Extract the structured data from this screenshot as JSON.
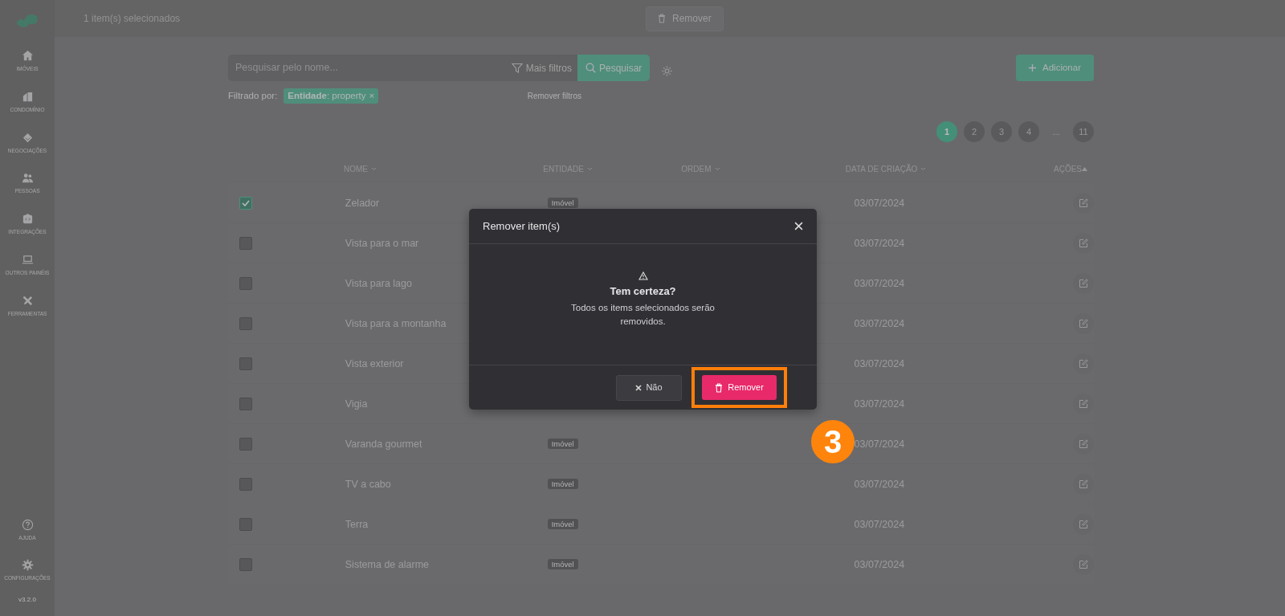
{
  "topbar": {
    "selection_text": "1 item(s) selecionados",
    "remove_button": "Remover"
  },
  "sidebar": {
    "items": [
      {
        "label": "IMÓVEIS"
      },
      {
        "label": "CONDOMÍNIO"
      },
      {
        "label": "NEGOCIAÇÕES"
      },
      {
        "label": "PESSOAS"
      },
      {
        "label": "INTEGRAÇÕES"
      },
      {
        "label": "OUTROS PAINÉIS"
      },
      {
        "label": "FERRAMENTAS"
      }
    ],
    "footer_items": [
      {
        "label": "AJUDA"
      },
      {
        "label": "CONFIGURAÇÕES"
      }
    ],
    "version": "v3.2.0"
  },
  "toolbar": {
    "search_placeholder": "Pesquisar pelo nome...",
    "filters_button": "Mais filtros",
    "search_button": "Pesquisar",
    "add_button": "Adicionar",
    "filter_label": "Filtrado por:",
    "filter_tag": "**Entidade**: property",
    "filter_tag_close": "×",
    "clear_filters": "Remover filtros"
  },
  "pagination": [
    {
      "label": "1",
      "selected": true
    },
    {
      "label": "2",
      "selected": false
    },
    {
      "label": "3",
      "selected": false
    },
    {
      "label": "4",
      "selected": false
    },
    {
      "label": "...",
      "kind": "ellipsis"
    },
    {
      "label": "11",
      "selected": false
    }
  ],
  "table": {
    "columns": [
      "NOME",
      "ENTIDADE",
      "ORDEM",
      "DATA DE CRIAÇÃO",
      "AÇÕES"
    ],
    "rows": [
      {
        "name": "Zelador",
        "entity": "Imóvel",
        "date": "03/07/2024",
        "checked": true
      },
      {
        "name": "Vista para o mar",
        "date": "03/07/2024",
        "checked": false
      },
      {
        "name": "Vista para lago",
        "date": "03/07/2024",
        "checked": false
      },
      {
        "name": "Vista para a montanha",
        "date": "03/07/2024",
        "checked": false
      },
      {
        "name": "Vista exterior",
        "date": "03/07/2024",
        "checked": false
      },
      {
        "name": "Vigia",
        "date": "03/07/2024",
        "checked": false
      },
      {
        "name": "Varanda gourmet",
        "entity": "Imóvel",
        "date": "03/07/2024",
        "checked": false
      },
      {
        "name": "TV a cabo",
        "entity": "Imóvel",
        "date": "03/07/2024",
        "checked": false
      },
      {
        "name": "Terra",
        "entity": "Imóvel",
        "date": "03/07/2024",
        "checked": false
      },
      {
        "name": "Sistema de alarme",
        "entity": "Imóvel",
        "date": "03/07/2024",
        "checked": false
      }
    ]
  },
  "modal": {
    "title": "Remover item(s)",
    "heading": "Tem certeza?",
    "message": "Todos os items selecionados serão removidos.",
    "cancel_button": "Não",
    "confirm_button": "Remover"
  },
  "callout": {
    "number": "3"
  }
}
